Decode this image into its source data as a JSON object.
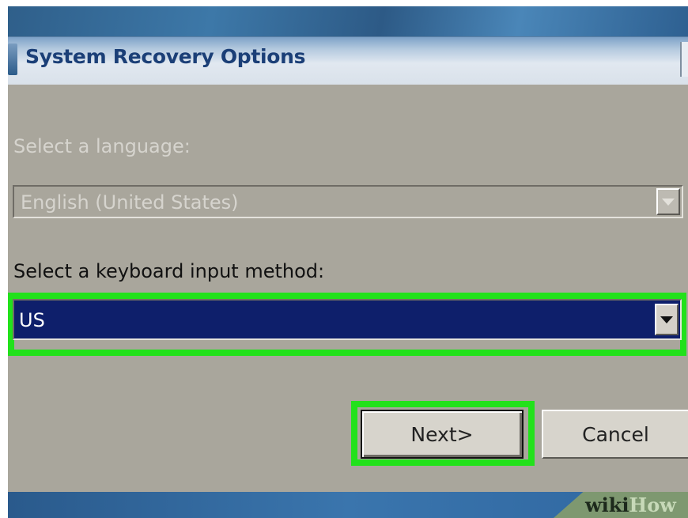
{
  "window": {
    "title": "System Recovery Options"
  },
  "language": {
    "label": "Select a language:",
    "selected": "English (United States)",
    "enabled": false
  },
  "keyboard": {
    "label": "Select a keyboard input method:",
    "selected": "US",
    "enabled": true
  },
  "buttons": {
    "next": "Next>",
    "cancel": "Cancel"
  },
  "watermark": {
    "part1": "wiki",
    "part2": "How"
  },
  "colors": {
    "dialog_background": "#a9a69c",
    "selection": "#0e1f6b",
    "highlight": "#22e11b",
    "title_text": "#1b3f77"
  },
  "icons": [
    "window-icon",
    "dropdown-arrow-icon"
  ]
}
